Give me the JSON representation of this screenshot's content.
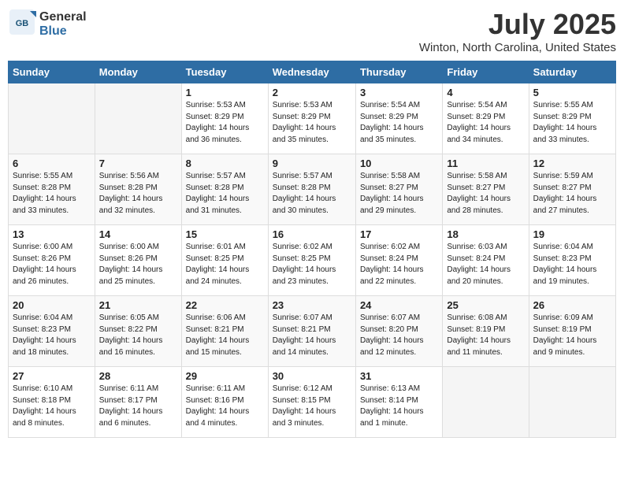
{
  "header": {
    "logo_general": "General",
    "logo_blue": "Blue",
    "month": "July 2025",
    "location": "Winton, North Carolina, United States"
  },
  "weekdays": [
    "Sunday",
    "Monday",
    "Tuesday",
    "Wednesday",
    "Thursday",
    "Friday",
    "Saturday"
  ],
  "weeks": [
    [
      {
        "day": "",
        "info": ""
      },
      {
        "day": "",
        "info": ""
      },
      {
        "day": "1",
        "info": "Sunrise: 5:53 AM\nSunset: 8:29 PM\nDaylight: 14 hours\nand 36 minutes."
      },
      {
        "day": "2",
        "info": "Sunrise: 5:53 AM\nSunset: 8:29 PM\nDaylight: 14 hours\nand 35 minutes."
      },
      {
        "day": "3",
        "info": "Sunrise: 5:54 AM\nSunset: 8:29 PM\nDaylight: 14 hours\nand 35 minutes."
      },
      {
        "day": "4",
        "info": "Sunrise: 5:54 AM\nSunset: 8:29 PM\nDaylight: 14 hours\nand 34 minutes."
      },
      {
        "day": "5",
        "info": "Sunrise: 5:55 AM\nSunset: 8:29 PM\nDaylight: 14 hours\nand 33 minutes."
      }
    ],
    [
      {
        "day": "6",
        "info": "Sunrise: 5:55 AM\nSunset: 8:28 PM\nDaylight: 14 hours\nand 33 minutes."
      },
      {
        "day": "7",
        "info": "Sunrise: 5:56 AM\nSunset: 8:28 PM\nDaylight: 14 hours\nand 32 minutes."
      },
      {
        "day": "8",
        "info": "Sunrise: 5:57 AM\nSunset: 8:28 PM\nDaylight: 14 hours\nand 31 minutes."
      },
      {
        "day": "9",
        "info": "Sunrise: 5:57 AM\nSunset: 8:28 PM\nDaylight: 14 hours\nand 30 minutes."
      },
      {
        "day": "10",
        "info": "Sunrise: 5:58 AM\nSunset: 8:27 PM\nDaylight: 14 hours\nand 29 minutes."
      },
      {
        "day": "11",
        "info": "Sunrise: 5:58 AM\nSunset: 8:27 PM\nDaylight: 14 hours\nand 28 minutes."
      },
      {
        "day": "12",
        "info": "Sunrise: 5:59 AM\nSunset: 8:27 PM\nDaylight: 14 hours\nand 27 minutes."
      }
    ],
    [
      {
        "day": "13",
        "info": "Sunrise: 6:00 AM\nSunset: 8:26 PM\nDaylight: 14 hours\nand 26 minutes."
      },
      {
        "day": "14",
        "info": "Sunrise: 6:00 AM\nSunset: 8:26 PM\nDaylight: 14 hours\nand 25 minutes."
      },
      {
        "day": "15",
        "info": "Sunrise: 6:01 AM\nSunset: 8:25 PM\nDaylight: 14 hours\nand 24 minutes."
      },
      {
        "day": "16",
        "info": "Sunrise: 6:02 AM\nSunset: 8:25 PM\nDaylight: 14 hours\nand 23 minutes."
      },
      {
        "day": "17",
        "info": "Sunrise: 6:02 AM\nSunset: 8:24 PM\nDaylight: 14 hours\nand 22 minutes."
      },
      {
        "day": "18",
        "info": "Sunrise: 6:03 AM\nSunset: 8:24 PM\nDaylight: 14 hours\nand 20 minutes."
      },
      {
        "day": "19",
        "info": "Sunrise: 6:04 AM\nSunset: 8:23 PM\nDaylight: 14 hours\nand 19 minutes."
      }
    ],
    [
      {
        "day": "20",
        "info": "Sunrise: 6:04 AM\nSunset: 8:23 PM\nDaylight: 14 hours\nand 18 minutes."
      },
      {
        "day": "21",
        "info": "Sunrise: 6:05 AM\nSunset: 8:22 PM\nDaylight: 14 hours\nand 16 minutes."
      },
      {
        "day": "22",
        "info": "Sunrise: 6:06 AM\nSunset: 8:21 PM\nDaylight: 14 hours\nand 15 minutes."
      },
      {
        "day": "23",
        "info": "Sunrise: 6:07 AM\nSunset: 8:21 PM\nDaylight: 14 hours\nand 14 minutes."
      },
      {
        "day": "24",
        "info": "Sunrise: 6:07 AM\nSunset: 8:20 PM\nDaylight: 14 hours\nand 12 minutes."
      },
      {
        "day": "25",
        "info": "Sunrise: 6:08 AM\nSunset: 8:19 PM\nDaylight: 14 hours\nand 11 minutes."
      },
      {
        "day": "26",
        "info": "Sunrise: 6:09 AM\nSunset: 8:19 PM\nDaylight: 14 hours\nand 9 minutes."
      }
    ],
    [
      {
        "day": "27",
        "info": "Sunrise: 6:10 AM\nSunset: 8:18 PM\nDaylight: 14 hours\nand 8 minutes."
      },
      {
        "day": "28",
        "info": "Sunrise: 6:11 AM\nSunset: 8:17 PM\nDaylight: 14 hours\nand 6 minutes."
      },
      {
        "day": "29",
        "info": "Sunrise: 6:11 AM\nSunset: 8:16 PM\nDaylight: 14 hours\nand 4 minutes."
      },
      {
        "day": "30",
        "info": "Sunrise: 6:12 AM\nSunset: 8:15 PM\nDaylight: 14 hours\nand 3 minutes."
      },
      {
        "day": "31",
        "info": "Sunrise: 6:13 AM\nSunset: 8:14 PM\nDaylight: 14 hours\nand 1 minute."
      },
      {
        "day": "",
        "info": ""
      },
      {
        "day": "",
        "info": ""
      }
    ]
  ]
}
